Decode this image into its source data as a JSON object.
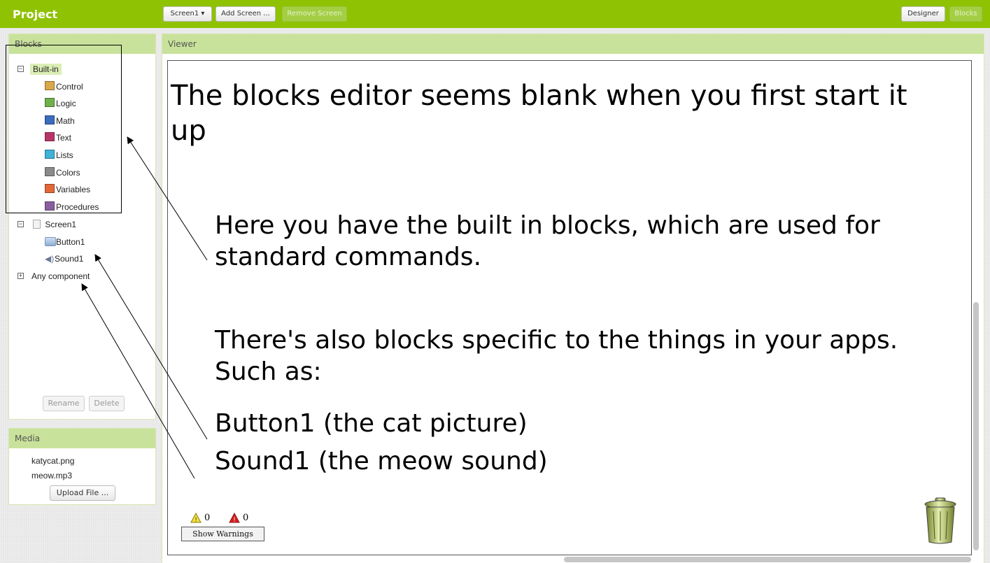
{
  "topbar": {
    "project_label": "Project",
    "screen_selector": "Screen1 ▾",
    "add_screen": "Add Screen ...",
    "remove_screen": "Remove Screen",
    "designer": "Designer",
    "blocks": "Blocks"
  },
  "blocks_panel": {
    "title": "Blocks",
    "builtin": {
      "label": "Built-in",
      "items": [
        {
          "label": "Control",
          "color": "#d9a84a"
        },
        {
          "label": "Logic",
          "color": "#6fb04b"
        },
        {
          "label": "Math",
          "color": "#3c6bbf"
        },
        {
          "label": "Text",
          "color": "#b8356a"
        },
        {
          "label": "Lists",
          "color": "#3fb2d6"
        },
        {
          "label": "Colors",
          "color": "#8a8a8a"
        },
        {
          "label": "Variables",
          "color": "#e2683a"
        },
        {
          "label": "Procedures",
          "color": "#8a5fa0"
        }
      ]
    },
    "screen": {
      "label": "Screen1",
      "items": [
        {
          "label": "Button1",
          "icon": "button-icon"
        },
        {
          "label": "Sound1",
          "icon": "speaker-icon"
        }
      ]
    },
    "any_component": "Any component",
    "rename": "Rename",
    "delete": "Delete"
  },
  "media_panel": {
    "title": "Media",
    "files": [
      "katycat.png",
      "meow.mp3"
    ],
    "upload": "Upload File ..."
  },
  "viewer": {
    "title": "Viewer",
    "annotation_title": "The blocks editor seems blank when you first start it up",
    "annotation_builtin": "Here you have the built in blocks, which are used for standard commands.",
    "annotation_specific": "There's also blocks specific to the things in your apps. Such as:",
    "annotation_button": "Button1 (the cat picture)",
    "annotation_sound": "Sound1 (the meow sound)",
    "warnings_count": "0",
    "errors_count": "0",
    "show_warnings": "Show Warnings"
  },
  "colors": {
    "topbar": "#8fc202",
    "panel_header": "#c9e29b"
  }
}
